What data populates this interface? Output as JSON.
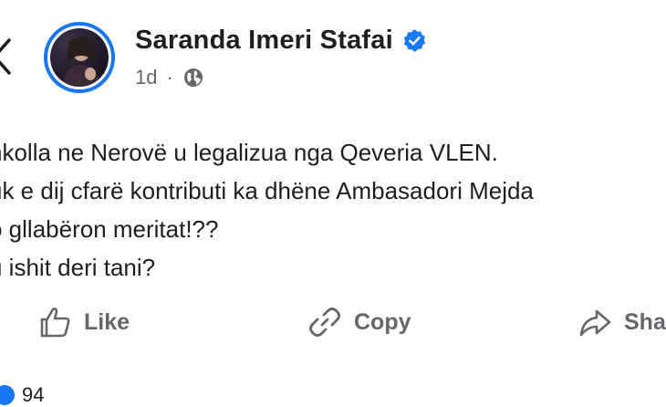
{
  "post": {
    "author": "Saranda Imeri Stafai",
    "time": "1d",
    "separator": "·",
    "lines": [
      "nkolla ne Nerovë u legalizua nga Qeveria VLEN.",
      "uk e dij cfarë kontributi ka dhëne Ambasadori Mejda",
      "o gllabëron meritat!??",
      "u ishit deri tani?"
    ]
  },
  "actions": {
    "like_label": "Like",
    "copy_label": "Copy",
    "share_label": "Sha"
  },
  "reactions": {
    "count": "94"
  },
  "colors": {
    "accent": "#1877f2",
    "muted": "#65676b",
    "text": "#1c1e21"
  },
  "icons": [
    "back-chevron-icon",
    "verified-badge-icon",
    "globe-icon",
    "thumbs-up-icon",
    "copy-link-icon",
    "share-arrow-icon"
  ]
}
